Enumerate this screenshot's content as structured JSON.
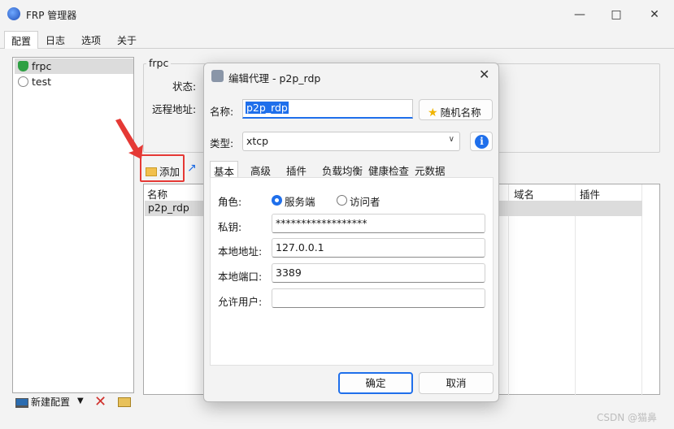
{
  "window": {
    "title": "FRP 管理器"
  },
  "main_tabs": [
    {
      "label": "配置",
      "active": true
    },
    {
      "label": "日志",
      "active": false
    },
    {
      "label": "选项",
      "active": false
    },
    {
      "label": "关于",
      "active": false
    }
  ],
  "configs": [
    {
      "name": "frpc",
      "icon": "shield-check-icon",
      "selected": true
    },
    {
      "name": "test",
      "icon": "status-circle-icon",
      "selected": false
    }
  ],
  "bottom": {
    "new_config_label": "新建配置"
  },
  "config_panel": {
    "group_title": "frpc",
    "status_label": "状态:",
    "remote_label": "远程地址:",
    "add_label": "添加"
  },
  "proxy_table": {
    "columns": [
      "名称",
      "域名",
      "插件"
    ],
    "rows": [
      {
        "name": "p2p_rdp"
      }
    ]
  },
  "dialog": {
    "title": "编辑代理 - p2p_rdp",
    "name_label": "名称:",
    "name_value": "p2p_rdp",
    "random_name_label": "随机名称",
    "type_label": "类型:",
    "type_value": "xtcp",
    "tabs": [
      {
        "label": "基本",
        "active": true
      },
      {
        "label": "高级",
        "active": false
      },
      {
        "label": "插件",
        "active": false
      },
      {
        "label": "负载均衡",
        "active": false
      },
      {
        "label": "健康检查",
        "active": false
      },
      {
        "label": "元数据",
        "active": false
      }
    ],
    "role_label": "角色:",
    "role_options": [
      {
        "label": "服务端",
        "checked": true
      },
      {
        "label": "访问者",
        "checked": false
      }
    ],
    "secret_label": "私钥:",
    "secret_value": "******************",
    "local_addr_label": "本地地址:",
    "local_addr_value": "127.0.0.1",
    "local_port_label": "本地端口:",
    "local_port_value": "3389",
    "allow_users_label": "允许用户:",
    "allow_users_value": "",
    "ok_label": "确定",
    "cancel_label": "取消"
  },
  "watermark": "CSDN @猫鼻",
  "colors": {
    "accent": "#1f6feb",
    "highlight": "#e53935"
  }
}
